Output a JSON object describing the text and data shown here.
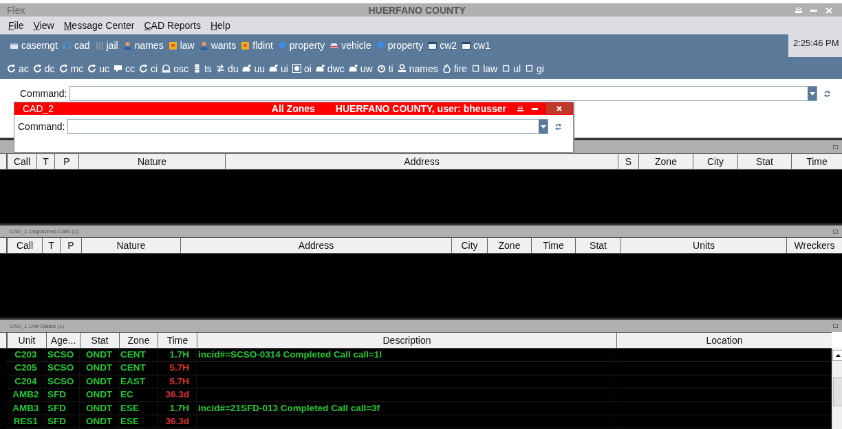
{
  "window": {
    "app": "Flex",
    "title": "HUERFANO COUNTY"
  },
  "menu": [
    "File",
    "View",
    "Message Center",
    "CAD Reports",
    "Help"
  ],
  "toolbar_1": [
    "casemgt",
    "cad",
    "jail",
    "names",
    "law",
    "wants",
    "fldint",
    "property",
    "vehicle",
    "property",
    "cw2",
    "cw1"
  ],
  "clock": "2:25:46 PM",
  "toolbar_2": [
    "ac",
    "dc",
    "mc",
    "uc",
    "cc",
    "ci",
    "osc",
    "ts",
    "du",
    "uu",
    "ui",
    "oi",
    "dwc",
    "uw",
    "ti",
    "names",
    "fire",
    "law",
    "ul",
    "gi"
  ],
  "command": {
    "label": "Command:"
  },
  "cad_window": {
    "title": "CAD_2",
    "zone": "All Zones",
    "info": "HUERFANO COUNTY, user: bheusser",
    "command_label": "Command:"
  },
  "calls_panel": {
    "columns": [
      "Call",
      "T",
      "P",
      "Nature",
      "Address",
      "S",
      "Zone",
      "City",
      "Stat",
      "Time"
    ]
  },
  "dispatched_panel": {
    "title": "CAD_1 Dispatched Calls (1)",
    "columns": [
      "Call",
      "T",
      "P",
      "Nature",
      "Address",
      "City",
      "Zone",
      "Time",
      "Stat",
      "Units",
      "Wreckers"
    ]
  },
  "unit_panel": {
    "title": "CAD_1 Unit Status (1)",
    "columns": [
      "Unit",
      "Age...",
      "Stat",
      "Zone",
      "Time",
      "Description",
      "Location"
    ],
    "rows": [
      {
        "unit": "C203",
        "agency": "SCSO",
        "stat": "ONDT",
        "zone": "CENT",
        "time": "1.7H",
        "overdue": false,
        "description": "incid#=SCSO-0314 Completed Call call=1l"
      },
      {
        "unit": "C205",
        "agency": "SCSO",
        "stat": "ONDT",
        "zone": "CENT",
        "time": "5.7H",
        "overdue": true
      },
      {
        "unit": "C204",
        "agency": "SCSO",
        "stat": "ONDT",
        "zone": "EAST",
        "time": "5.7H",
        "overdue": true
      },
      {
        "unit": "AMB2",
        "agency": "SFD",
        "stat": "ONDT",
        "zone": "EC",
        "time": "36.3d",
        "overdue": true
      },
      {
        "unit": "AMB3",
        "agency": "SFD",
        "stat": "ONDT",
        "zone": "ESE",
        "time": "1.7H",
        "overdue": false,
        "description": "incid#=21SFD-013 Completed Call call=3f"
      },
      {
        "unit": "RES1",
        "agency": "SFD",
        "stat": "ONDT",
        "zone": "ESE",
        "time": "36.3d",
        "overdue": true
      }
    ]
  }
}
